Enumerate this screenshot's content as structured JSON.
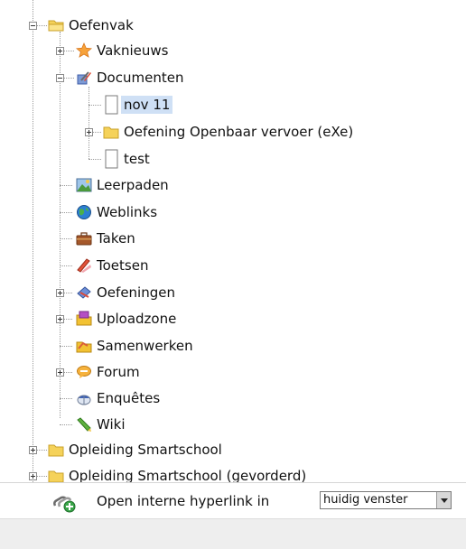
{
  "tree": {
    "root": {
      "label": "Oefenvak",
      "icon": "folder-open-icon"
    },
    "items": [
      {
        "label": "Vaknieuws",
        "icon": "star-icon",
        "expander": "plus"
      },
      {
        "label": "Documenten",
        "icon": "documents-tools-icon",
        "expander": "minus"
      },
      {
        "label": "nov 11",
        "icon": "document-page-icon",
        "selected": true
      },
      {
        "label": "Oefening Openbaar vervoer (eXe)",
        "icon": "folder-icon",
        "expander": "plus"
      },
      {
        "label": "test",
        "icon": "document-page-icon"
      },
      {
        "label": "Leerpaden",
        "icon": "learning-path-icon"
      },
      {
        "label": "Weblinks",
        "icon": "globe-icon"
      },
      {
        "label": "Taken",
        "icon": "briefcase-icon"
      },
      {
        "label": "Toetsen",
        "icon": "test-pencil-icon"
      },
      {
        "label": "Oefeningen",
        "icon": "exercise-icon",
        "expander": "plus"
      },
      {
        "label": "Uploadzone",
        "icon": "upload-folder-icon",
        "expander": "plus"
      },
      {
        "label": "Samenwerken",
        "icon": "collaborate-folder-icon"
      },
      {
        "label": "Forum",
        "icon": "chat-bubble-icon",
        "expander": "plus"
      },
      {
        "label": "Enquêtes",
        "icon": "survey-mouse-icon"
      },
      {
        "label": "Wiki",
        "icon": "wiki-pencil-icon"
      }
    ],
    "siblings": [
      {
        "label": "Opleiding Smartschool",
        "icon": "folder-icon",
        "expander": "plus"
      },
      {
        "label": "Opleiding Smartschool (gevorderd)",
        "icon": "folder-icon",
        "expander": "plus"
      }
    ]
  },
  "bottom": {
    "icon": "add-link-icon",
    "label": "Open interne hyperlink in",
    "select_value": "huidig venster"
  },
  "colors": {
    "folder_yellow": "#f5d25a",
    "selection_bg": "#cfe0f5"
  }
}
